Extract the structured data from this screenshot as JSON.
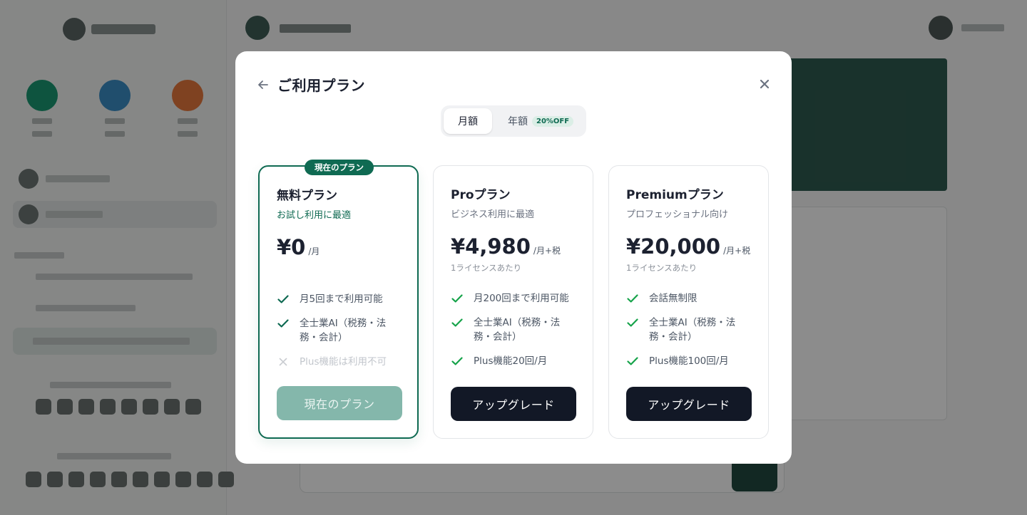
{
  "modal": {
    "title": "ご利用プラン",
    "billing_toggle": {
      "monthly_label": "月額",
      "annual_label": "年額",
      "annual_badge": "20%OFF",
      "selected": "monthly"
    },
    "plans": [
      {
        "name": "無料プラン",
        "subtitle": "お試し利用に最適",
        "badge": "現在のプラン",
        "price": "¥0",
        "period": "/月",
        "per_license": "",
        "features": [
          {
            "text": "月5回まで利用可能",
            "included": true
          },
          {
            "text": "全士業AI（税務・法務・会計）",
            "included": true
          },
          {
            "text": "Plus機能は利用不可",
            "included": false
          }
        ],
        "button_label": "現在のプラン",
        "button_state": "disabled"
      },
      {
        "name": "Proプラン",
        "subtitle": "ビジネス利用に最適",
        "price": "¥4,980",
        "period": "/月+税",
        "per_license": "1ライセンスあたり",
        "features": [
          {
            "text": "月200回まで利用可能",
            "included": true
          },
          {
            "text": "全士業AI（税務・法務・会計）",
            "included": true
          },
          {
            "text": "Plus機能20回/月",
            "included": true
          }
        ],
        "button_label": "アップグレード",
        "button_state": "enabled"
      },
      {
        "name": "Premiumプラン",
        "subtitle": "プロフェッショナル向け",
        "price": "¥20,000",
        "period": "/月+税",
        "per_license": "1ライセンスあたり",
        "features": [
          {
            "text": "会話無制限",
            "included": true
          },
          {
            "text": "全士業AI（税務・法務・会計）",
            "included": true
          },
          {
            "text": "Plus機能100回/月",
            "included": true
          }
        ],
        "button_label": "アップグレード",
        "button_state": "enabled"
      }
    ]
  },
  "colors": {
    "accent": "#0f6a52",
    "check": "#16a34a",
    "button_dark": "#121826",
    "button_disabled": "#84b7ab",
    "overlay": "rgba(0,0,0,0.45)"
  },
  "icons": {
    "back": "arrow-left-icon",
    "close": "close-icon",
    "included": "check-icon",
    "excluded": "x-icon"
  }
}
